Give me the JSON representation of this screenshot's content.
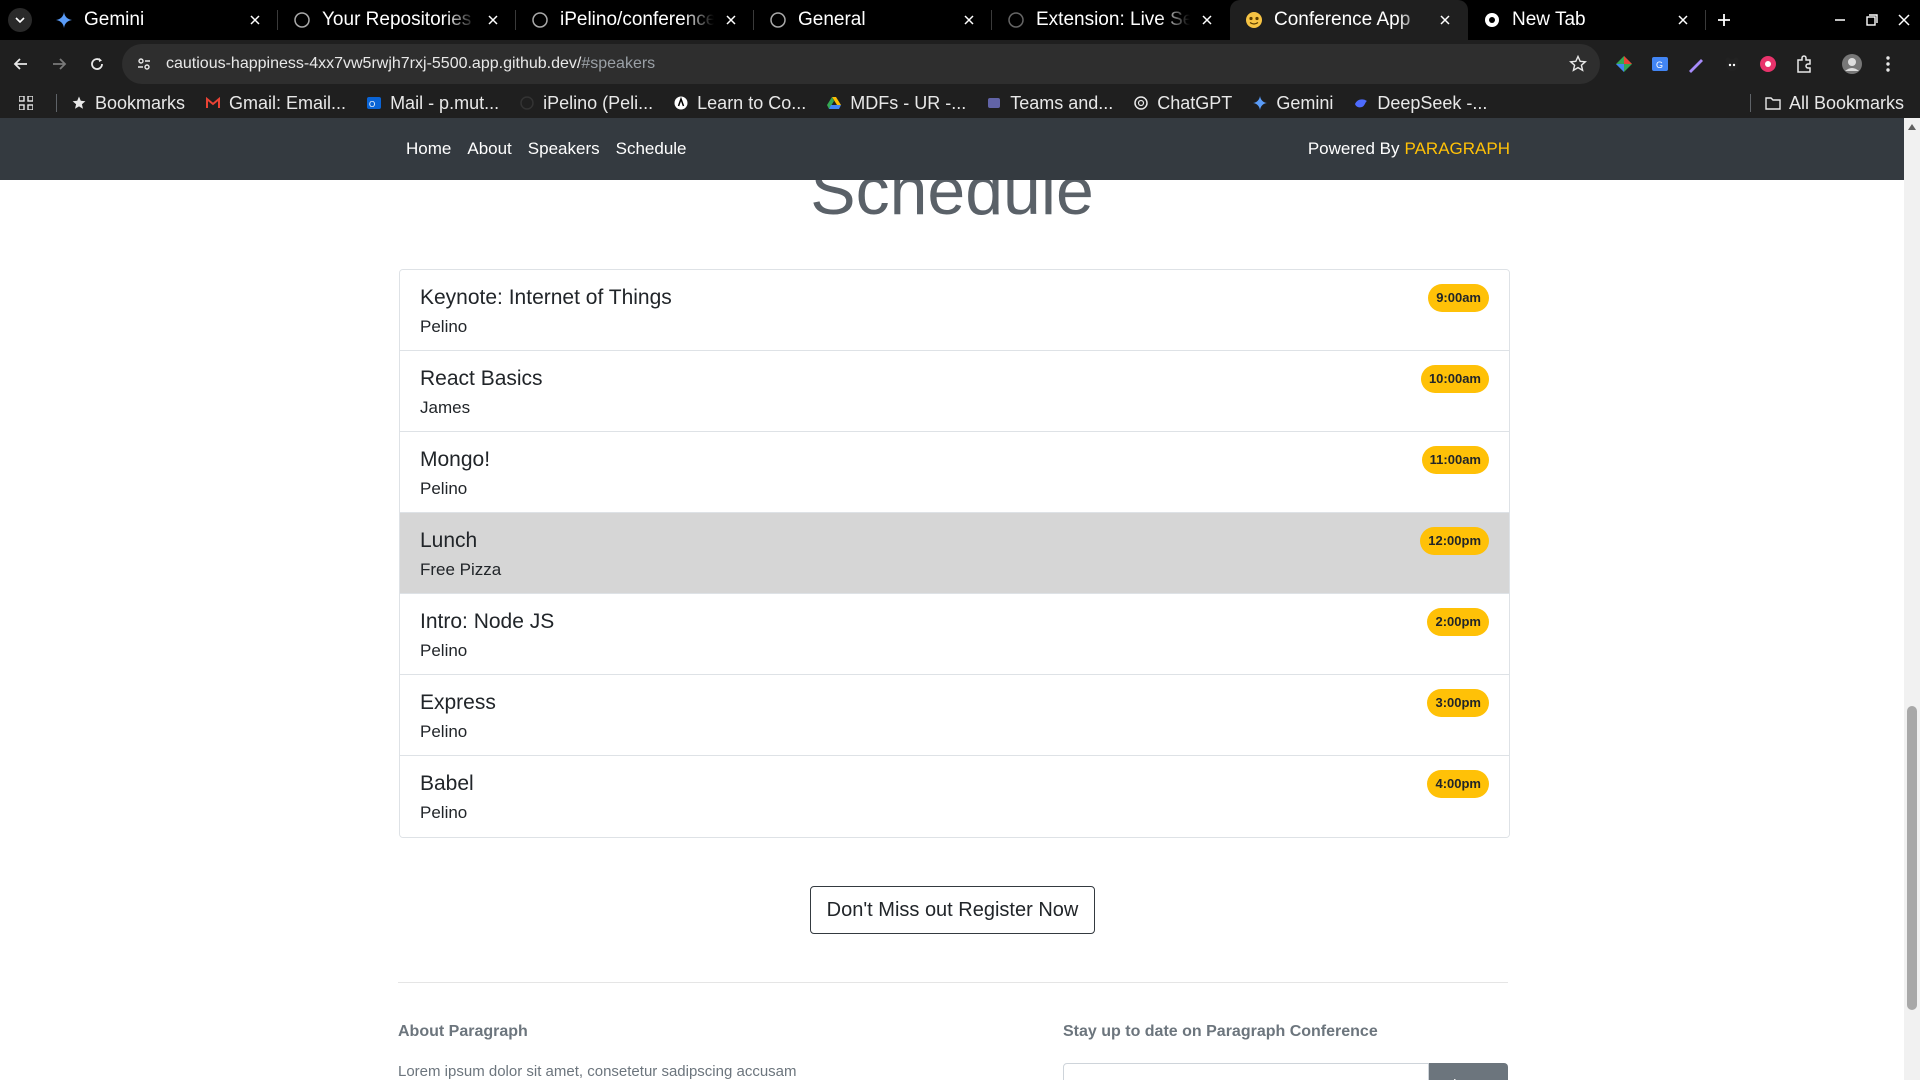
{
  "browser": {
    "tabs": [
      {
        "title": "Gemini",
        "icon": "gemini-icon"
      },
      {
        "title": "Your Repositories",
        "icon": "github-icon"
      },
      {
        "title": "iPelino/conference_p",
        "icon": "github-icon"
      },
      {
        "title": "General",
        "icon": "github-icon"
      },
      {
        "title": "Extension: Live Serv",
        "icon": "github-icon"
      },
      {
        "title": "Conference App",
        "icon": "emoji-icon",
        "active": true
      },
      {
        "title": "New Tab",
        "icon": "chrome-icon"
      }
    ],
    "url_host": "cautious-happiness-4xx7vw5rwjh7rxj-5500.app.github.dev/",
    "url_path": "#speakers",
    "bookmarks": [
      {
        "label": "Bookmarks",
        "icon": "star-icon"
      },
      {
        "label": "Gmail: Email...",
        "icon": "gmail-icon"
      },
      {
        "label": "Mail - p.mut...",
        "icon": "outlook-icon"
      },
      {
        "label": "iPelino (Peli...",
        "icon": "github-icon"
      },
      {
        "label": "Learn to Co...",
        "icon": "code-icon"
      },
      {
        "label": "MDFs - UR -...",
        "icon": "drive-icon"
      },
      {
        "label": "Teams and...",
        "icon": "teams-icon"
      },
      {
        "label": "ChatGPT",
        "icon": "chatgpt-icon"
      },
      {
        "label": "Gemini",
        "icon": "gemini-icon"
      },
      {
        "label": "DeepSeek -...",
        "icon": "deepseek-icon"
      }
    ],
    "all_bookmarks": "All Bookmarks"
  },
  "nav": {
    "links": [
      "Home",
      "About",
      "Speakers",
      "Schedule"
    ],
    "powered_by": "Powered By",
    "brand": "PARAGRAPH",
    "brand_color": "#ffc107"
  },
  "schedule": {
    "heading": "Schedule",
    "items": [
      {
        "title": "Keynote: Internet of Things",
        "speaker": "Pelino",
        "time": "9:00am"
      },
      {
        "title": "React Basics",
        "speaker": "James",
        "time": "10:00am"
      },
      {
        "title": "Mongo!",
        "speaker": "Pelino",
        "time": "11:00am"
      },
      {
        "title": "Lunch",
        "speaker": "Free Pizza",
        "time": "12:00pm",
        "muted": true
      },
      {
        "title": "Intro: Node JS",
        "speaker": "Pelino",
        "time": "2:00pm"
      },
      {
        "title": "Express",
        "speaker": "Pelino",
        "time": "3:00pm"
      },
      {
        "title": "Babel",
        "speaker": "Pelino",
        "time": "4:00pm"
      }
    ]
  },
  "register": {
    "label": "Don't Miss out Register Now"
  },
  "footer": {
    "about_title": "About Paragraph",
    "about_text": "Lorem ipsum dolor sit amet, consetetur sadipscing accusam",
    "stay_title": "Stay up to date on Paragraph Conference",
    "signup_label": "Sign up"
  }
}
